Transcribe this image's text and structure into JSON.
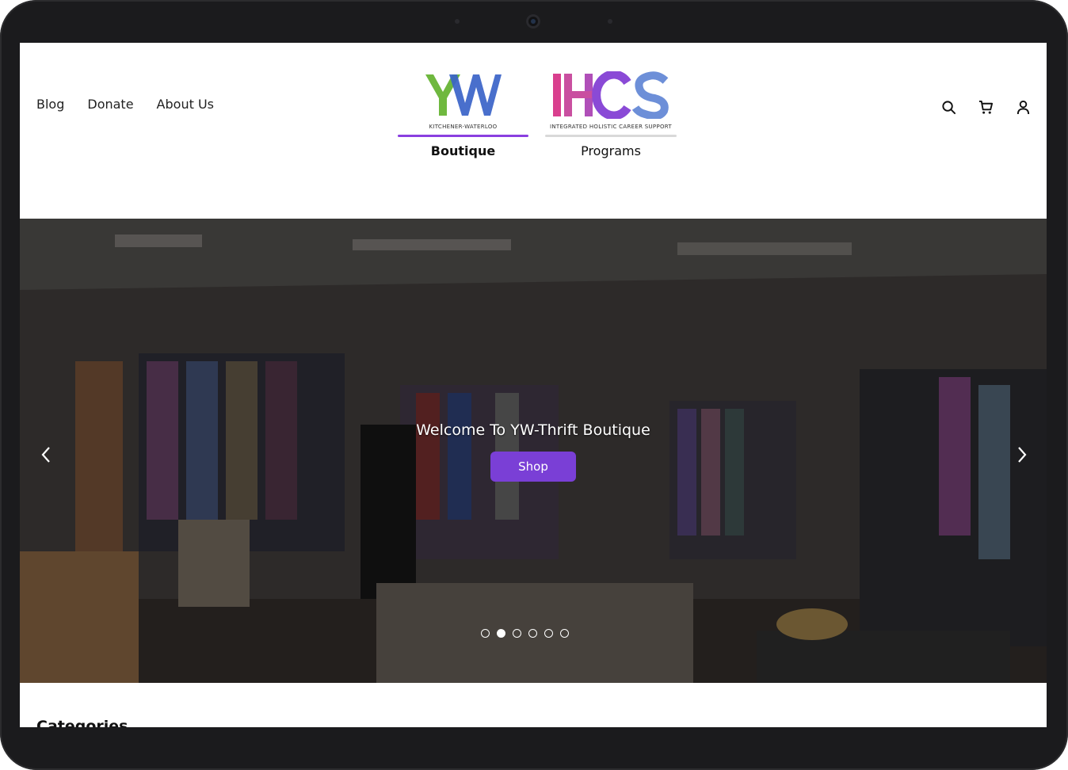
{
  "nav": {
    "items": [
      "Blog",
      "Donate",
      "About Us"
    ]
  },
  "brands": [
    {
      "mark": "YW",
      "subtitle": "KITCHENER-WATERLOO",
      "label": "Boutique",
      "active": true,
      "bar_color": "#8a3fe0"
    },
    {
      "mark": "IHCS",
      "subtitle": "INTEGRATED HOLISTIC CAREER SUPPORT",
      "label": "Programs",
      "active": false,
      "bar_color": "#d9d9d9"
    }
  ],
  "header_icons": [
    "search-icon",
    "cart-icon",
    "user-icon"
  ],
  "hero": {
    "title": "Welcome To YW-Thrift Boutique",
    "button_label": "Shop",
    "button_color": "#7a3fd6",
    "slide_count": 6,
    "active_slide": 2
  },
  "section": {
    "title": "Categories"
  },
  "colors": {
    "yw_green": "#6fb83f",
    "yw_blue": "#3a63c8",
    "ihcs_pink": "#d93f8e",
    "ihcs_purple": "#8a4ad6",
    "ihcs_blue": "#6d8fd8"
  }
}
